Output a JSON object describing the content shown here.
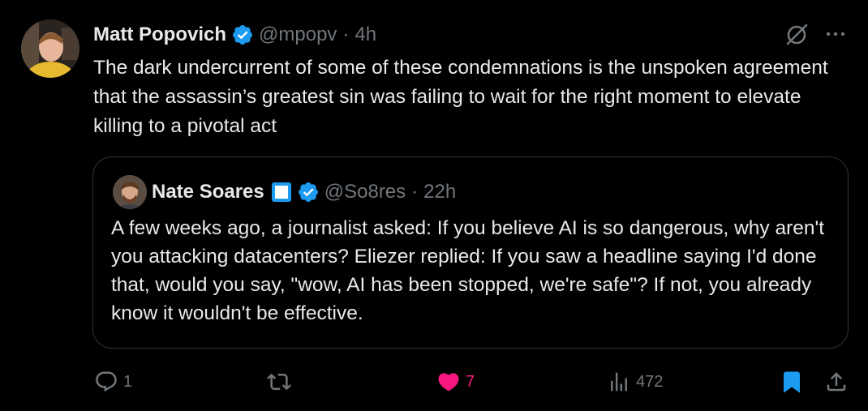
{
  "tweet": {
    "author_name": "Matt Popovich",
    "handle": "@mpopv",
    "time": "4h",
    "text": "The dark undercurrent of some of these condemnations is the unspoken agreement that the assassin’s greatest sin was failing to wait for the right moment to elevate killing to a pivotal act",
    "icons": {
      "verified": "verified-badge-icon",
      "grok": "grok-icon",
      "more": "more-icon"
    }
  },
  "quote": {
    "author_name": "Nate Soares",
    "handle": "@So8res",
    "time": "22h",
    "text": "A few weeks ago, a journalist asked: If you believe AI is so dangerous, why aren't you attacking datacenters?  Eliezer replied: If you saw a headline saying I'd done that, would you say, \"wow, AI has been stopped, we're safe\"?  If not, you already know it wouldn't be effective."
  },
  "actions": {
    "replies": "1",
    "retweets": "",
    "likes": "7",
    "views": "472"
  },
  "colors": {
    "background": "#000000",
    "text": "#e7e9ea",
    "muted": "#71767b",
    "verified": "#1d9bf0",
    "like": "#f91880",
    "bookmark": "#1d9bf0"
  }
}
